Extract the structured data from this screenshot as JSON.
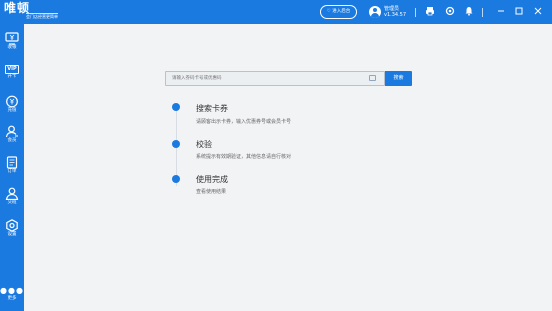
{
  "app": {
    "title": "唯顿",
    "subtitle": "会门店经营更简单"
  },
  "topbar": {
    "enter_store_label": "♡ 进入后台",
    "user_name": "管理员",
    "version": "v1.34.57",
    "icons": [
      "print-icon",
      "refresh-icon",
      "bell-icon",
      "minimize-icon",
      "maximize-icon",
      "close-icon"
    ]
  },
  "sidebar": {
    "items": [
      {
        "label": "收银",
        "icon": "cashier-icon"
      },
      {
        "label": "开卡",
        "icon": "vip-card-icon",
        "badge": "VIP"
      },
      {
        "label": "充值",
        "icon": "recharge-icon"
      },
      {
        "label": "会员",
        "icon": "member-icon"
      },
      {
        "label": "订单",
        "icon": "order-icon"
      },
      {
        "label": "交班",
        "icon": "handover-icon"
      },
      {
        "label": "设置",
        "icon": "settings-icon"
      }
    ],
    "more_label": "更多"
  },
  "search": {
    "placeholder": "请输入券码卡号或优惠码",
    "button_label": "搜索"
  },
  "steps": [
    {
      "title": "搜索卡券",
      "desc": "请顾客出示卡券，输入优惠券号或会员卡号"
    },
    {
      "title": "校验",
      "desc": "系统提示有效期验证，其他信息请自行核对"
    },
    {
      "title": "使用完成",
      "desc": "查看使用结果"
    }
  ],
  "colors": {
    "primary": "#1a7ae0",
    "background": "#f2f3f5"
  }
}
